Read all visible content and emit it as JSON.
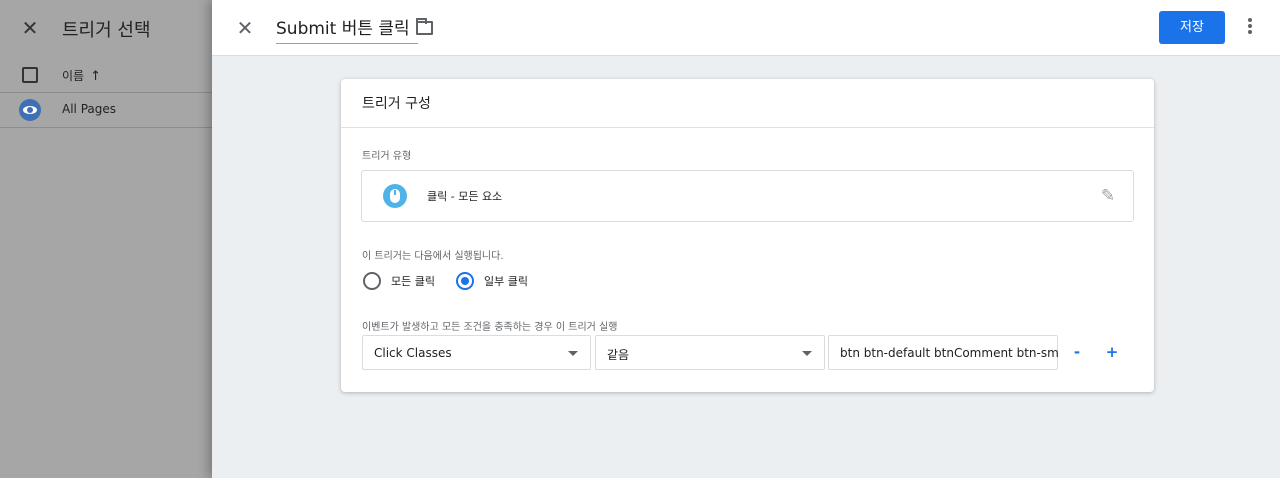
{
  "background_panel": {
    "close_icon": "close-icon",
    "title": "트리거 선택",
    "column_header": "이름",
    "sort_arrow": "↑",
    "rows": [
      {
        "label": "All Pages",
        "icon": "eye-icon"
      }
    ]
  },
  "topbar": {
    "close_icon": "close-icon",
    "name": "Submit 버튼 클릭",
    "folder_icon": "folder-icon",
    "save_label": "저장",
    "more_icon": "more-vert-icon"
  },
  "card": {
    "title": "트리거 구성",
    "trigger_type_label": "트리거 유형",
    "trigger_type_value": "클릭 - 모든 요소",
    "fires_on_label": "이 트리거는 다음에서 실행됩니다.",
    "radio_options": [
      {
        "label": "모든 클릭",
        "checked": false
      },
      {
        "label": "일부 클릭",
        "checked": true
      }
    ],
    "condition_label": "이벤트가 발생하고 모든 조건을 충족하는 경우 이 트리거 실행",
    "condition": {
      "variable": "Click Classes",
      "operator": "같음",
      "value": "btn btn-default btnComment btn-sm"
    },
    "remove_label": "-",
    "add_label": "+"
  },
  "colors": {
    "accent": "#1a73e8",
    "mouse_badge": "#4fb3ea"
  }
}
